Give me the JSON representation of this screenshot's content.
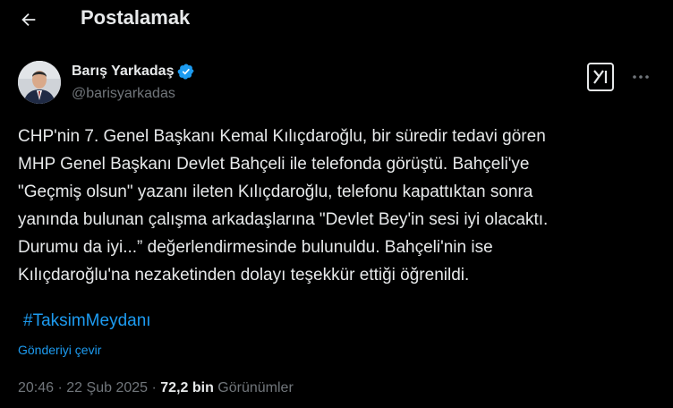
{
  "header": {
    "back_icon": "arrow-left-icon",
    "title": "Postalamak"
  },
  "author": {
    "name": "Barış Yarkadaş",
    "handle": "@barisyarkadas",
    "verified_icon": "verified-badge-icon",
    "verified_color": "#1d9bf0"
  },
  "actions": {
    "grok_icon": "grok-icon",
    "more_icon": "more-horizontal-icon"
  },
  "tweet": {
    "lines": [
      "CHP'nin 7. Genel Başkanı Kemal Kılıçdaroğlu, bir süredir tedavi gören",
      "MHP Genel Başkanı Devlet Bahçeli ile telefonda görüştü. Bahçeli'ye",
      "\"Geçmiş olsun\" yazanı ileten Kılıçdaroğlu, telefonu kapattıktan sonra",
      "yanında bulunan çalışma arkadaşlarına \"Devlet Bey'in sesi iyi olacaktı.",
      "Durumu da iyi...” değerlendirmesinde bulunuldu. Bahçeli'nin ise",
      "Kılıçdaroğlu'na nezaketinden dolayı teşekkür ettiği öğrenildi."
    ],
    "hashtag": "#TaksimMeydanı",
    "translate": "Gönderiyi çevir"
  },
  "meta": {
    "time": "20:46",
    "separator": "·",
    "date": "22 Şub 2025",
    "views_count": "72,2 bin",
    "views_label": "Görünümler"
  },
  "colors": {
    "background": "#000000",
    "text": "#e7e9ea",
    "muted": "#71767b",
    "link": "#1d9bf0"
  }
}
